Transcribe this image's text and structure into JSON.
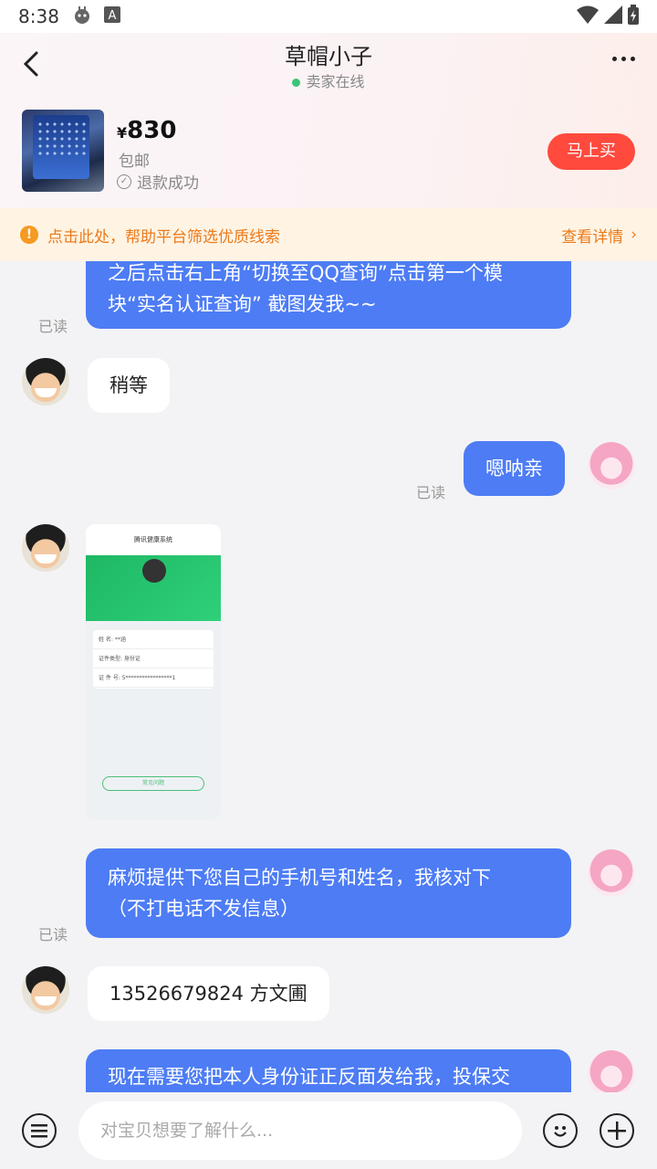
{
  "status_bar": {
    "time": "8:38",
    "app_icon_letter": "A"
  },
  "header": {
    "title": "草帽小子",
    "online_status": "卖家在线"
  },
  "product": {
    "currency": "¥",
    "price": "830",
    "shipping": "包邮",
    "status": "退款成功",
    "buy_label": "马上买"
  },
  "notice": {
    "text": "点击此处，帮助平台筛选优质线索",
    "detail_label": "查看详情"
  },
  "messages": [
    {
      "from": "me",
      "lines": [
        "之后点击右上角“切换至QQ查询”点击第一个模",
        "块“实名认证查询” 截图发我~~"
      ],
      "read": "已读"
    },
    {
      "from": "them",
      "lines": [
        "稍等"
      ]
    },
    {
      "from": "me",
      "lines": [
        "嗯呐亲"
      ],
      "read": "已读"
    },
    {
      "from": "them",
      "image": {
        "header": "腾讯健康系统",
        "rows": [
          "姓    名:  **涵",
          "证件类型:  身份证",
          "证  件  号:  5*****************1"
        ],
        "button": "常见问题"
      }
    },
    {
      "from": "me",
      "lines": [
        "麻烦提供下您自己的手机号和姓名，我核对下",
        "（不打电话不发信息）"
      ],
      "read": "已读"
    },
    {
      "from": "them",
      "lines": [
        "13526679824 方文圃"
      ]
    },
    {
      "from": "me",
      "lines": [
        "现在需要您把本人身份证正反面发给我，投保交"
      ]
    }
  ],
  "input": {
    "placeholder": "对宝贝想要了解什么..."
  },
  "colors": {
    "accent_blue": "#4d7cf4",
    "buy_red": "#ff4a3d",
    "notice_orange": "#ec7a1a",
    "online_green": "#3cc47a"
  }
}
